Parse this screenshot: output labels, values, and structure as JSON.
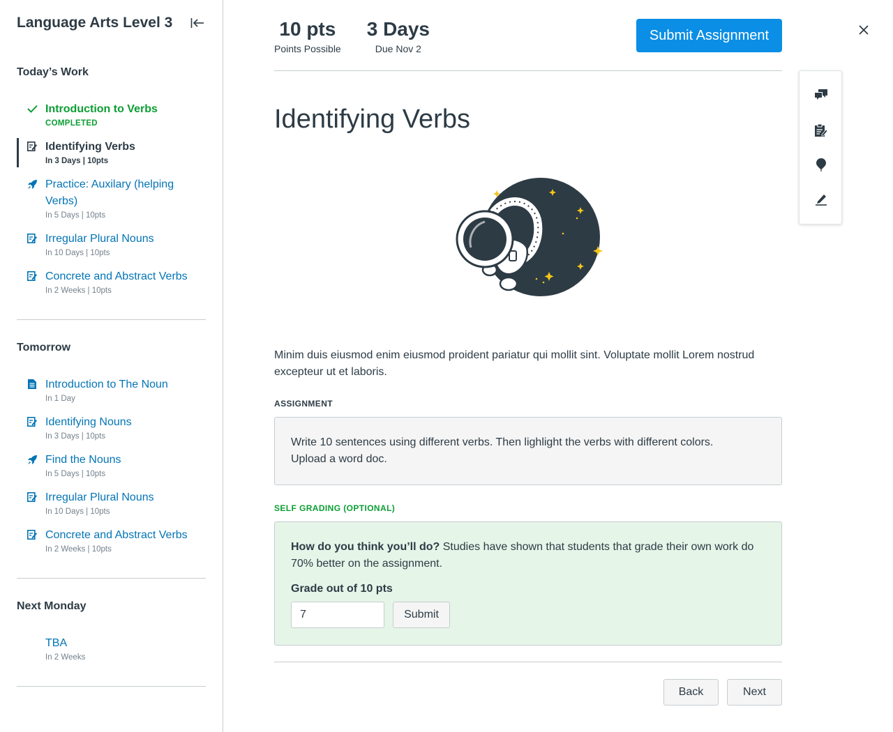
{
  "sidebar": {
    "title": "Language Arts Level 3",
    "sections": [
      {
        "title": "Today’s Work",
        "items": [
          {
            "label": "Introduction to Verbs",
            "meta": "COMPLETED",
            "icon": "checkmark-icon"
          },
          {
            "label": "Identifying Verbs",
            "meta": "In 3 Days  |  10pts",
            "icon": "assignment-icon"
          },
          {
            "label": "Practice: Auxilary (helping Verbs)",
            "meta": "In 5 Days  |  10pts",
            "icon": "rocket-icon"
          },
          {
            "label": "Irregular Plural Nouns",
            "meta": "In 10 Days  |  10pts",
            "icon": "assignment-icon"
          },
          {
            "label": "Concrete and Abstract Verbs",
            "meta": "In 2 Weeks  |  10pts",
            "icon": "assignment-icon"
          }
        ]
      },
      {
        "title": "Tomorrow",
        "items": [
          {
            "label": "Introduction to The Noun",
            "meta": "In 1 Day",
            "icon": "document-icon"
          },
          {
            "label": "Identifying Nouns",
            "meta": "In 3 Days  |  10pts",
            "icon": "assignment-icon"
          },
          {
            "label": "Find the Nouns",
            "meta": "In 5 Days  |  10pts",
            "icon": "rocket-icon"
          },
          {
            "label": "Irregular Plural Nouns",
            "meta": "In 10 Days  |  10pts",
            "icon": "assignment-icon"
          },
          {
            "label": "Concrete and Abstract Verbs",
            "meta": "In 2 Weeks  |  10pts",
            "icon": "assignment-icon"
          }
        ]
      },
      {
        "title": "Next Monday",
        "items": [
          {
            "label": "TBA",
            "meta": "In 2 Weeks"
          }
        ]
      }
    ]
  },
  "header": {
    "points_value": "10 pts",
    "points_label": "Points Possible",
    "due_value": "3 Days",
    "due_label": "Due Nov 2",
    "submit_label": "Submit Assignment"
  },
  "main": {
    "title": "Identifying Verbs",
    "description": "Minim duis eiusmod enim eiusmod proident pariatur qui mollit sint. Voluptate mollit Lorem nostrud excepteur ut et laboris.",
    "assignment_heading": "ASSIGNMENT",
    "assignment_line1": "Write 10 sentences using different verbs. Then lighlight the verbs with different colors.",
    "assignment_line2": "Upload a word doc.",
    "self_grading_heading": "SELF GRADING (OPTIONAL)",
    "self_grading_question": "How do you think you’ll do?",
    "self_grading_text": " Studies have shown that students that grade their own work do 70% better on the assignment.",
    "grade_label": "Grade out of 10 pts",
    "grade_value": "7",
    "grade_submit_label": "Submit",
    "back_label": "Back",
    "next_label": "Next"
  },
  "colors": {
    "accent": "#0b8ee5",
    "link": "#0374b5",
    "success": "#0b9e33",
    "text": "#2d3b45",
    "self_grading_bg": "#e5f5e8"
  },
  "tray": [
    "chat-bubbles-icon",
    "notes-icon",
    "pin-icon",
    "pencil-icon"
  ]
}
